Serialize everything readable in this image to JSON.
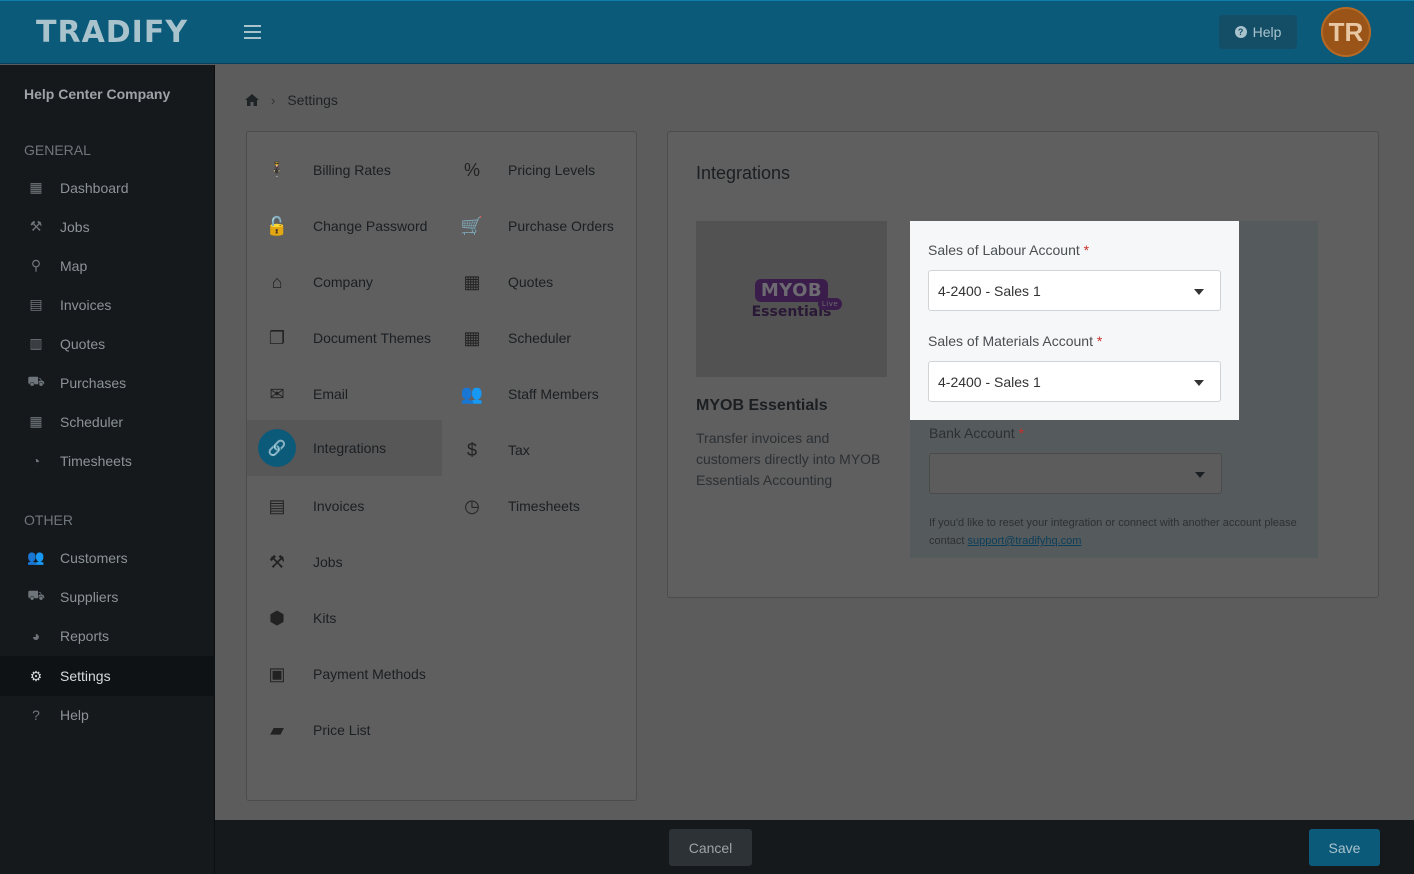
{
  "header": {
    "logo": "TRADIFY",
    "help_label": "Help",
    "avatar_initials": "TR"
  },
  "sidebar": {
    "company": "Help Center Company",
    "general_label": "GENERAL",
    "other_label": "OTHER",
    "general_items": [
      {
        "label": "Dashboard",
        "icon": "dashboard-icon"
      },
      {
        "label": "Jobs",
        "icon": "hammer-icon"
      },
      {
        "label": "Map",
        "icon": "map-pin-icon"
      },
      {
        "label": "Invoices",
        "icon": "invoice-icon"
      },
      {
        "label": "Quotes",
        "icon": "calculator-icon"
      },
      {
        "label": "Purchases",
        "icon": "cart-icon"
      },
      {
        "label": "Scheduler",
        "icon": "calendar-icon"
      },
      {
        "label": "Timesheets",
        "icon": "clock-icon"
      }
    ],
    "other_items": [
      {
        "label": "Customers",
        "icon": "users-icon"
      },
      {
        "label": "Suppliers",
        "icon": "truck-icon"
      },
      {
        "label": "Reports",
        "icon": "pie-chart-icon"
      },
      {
        "label": "Settings",
        "icon": "gear-icon"
      },
      {
        "label": "Help",
        "icon": "help-icon"
      }
    ],
    "active": "Settings"
  },
  "breadcrumb": {
    "current": "Settings"
  },
  "settings_menu": {
    "left": [
      {
        "label": "Billing Rates",
        "icon": "person-icon"
      },
      {
        "label": "Change Password",
        "icon": "unlock-icon"
      },
      {
        "label": "Company",
        "icon": "home-icon"
      },
      {
        "label": "Document Themes",
        "icon": "copy-icon"
      },
      {
        "label": "Email",
        "icon": "envelope-icon"
      },
      {
        "label": "Integrations",
        "icon": "link-icon"
      },
      {
        "label": "Invoices",
        "icon": "file-icon"
      },
      {
        "label": "Jobs",
        "icon": "hammer-icon"
      },
      {
        "label": "Kits",
        "icon": "cubes-icon"
      },
      {
        "label": "Payment Methods",
        "icon": "money-icon"
      },
      {
        "label": "Price List",
        "icon": "book-icon"
      }
    ],
    "right": [
      {
        "label": "Pricing Levels",
        "icon": "percent-icon"
      },
      {
        "label": "Purchase Orders",
        "icon": "cart-icon"
      },
      {
        "label": "Quotes",
        "icon": "calculator-icon"
      },
      {
        "label": "Scheduler",
        "icon": "calendar-icon"
      },
      {
        "label": "Staff Members",
        "icon": "users-icon"
      },
      {
        "label": "Tax",
        "icon": "dollar-icon"
      },
      {
        "label": "Timesheets",
        "icon": "clock-icon"
      }
    ],
    "active": "Integrations"
  },
  "integrations": {
    "title": "Integrations",
    "logo_main": "MYOB",
    "logo_badge": "Live",
    "logo_sub": "Essentials",
    "product_name": "MYOB Essentials",
    "description": "Transfer invoices and customers directly into MYOB Essentials Accounting",
    "fields": {
      "labour": {
        "label": "Sales of Labour Account",
        "value": "4-2400 - Sales 1"
      },
      "materials": {
        "label": "Sales of Materials Account",
        "value": "4-2400 - Sales 1"
      },
      "bank": {
        "label": "Bank Account",
        "value": ""
      }
    },
    "required_mark": "*",
    "note_text": "If you'd like to reset your integration or connect with another account please contact ",
    "note_link": "support@tradifyhq.com"
  },
  "footer": {
    "cancel_label": "Cancel",
    "save_label": "Save"
  },
  "colors": {
    "brand": "#0e7fa8",
    "avatar": "#c97a2c",
    "required": "#e53935"
  }
}
